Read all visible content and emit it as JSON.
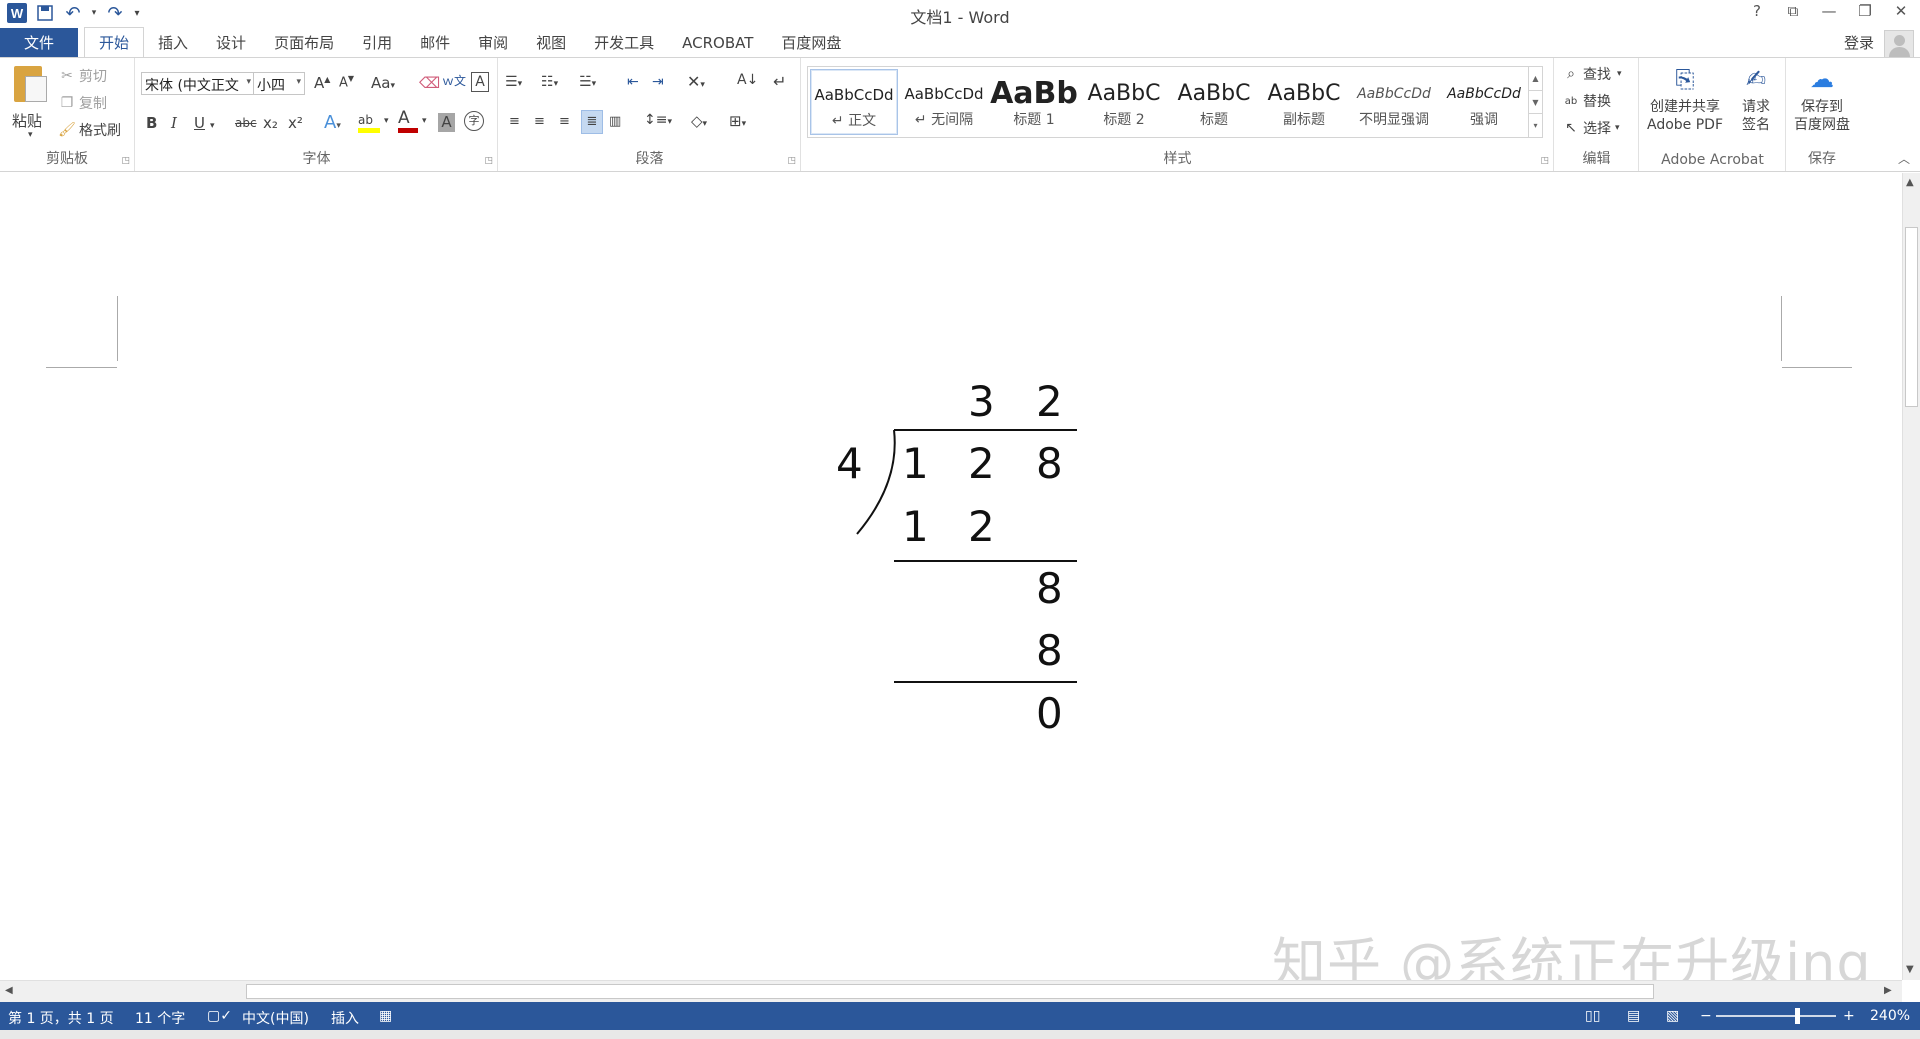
{
  "window": {
    "title": "文档1 - Word",
    "help": "?",
    "ribbon_options": "⧉",
    "minimize": "—",
    "restore": "❐",
    "close": "✕"
  },
  "qat": {
    "word_logo": "W",
    "save": "💾",
    "undo": "↶",
    "redo": "↷",
    "customize": "▾"
  },
  "tabs": [
    {
      "label": "文件"
    },
    {
      "label": "开始"
    },
    {
      "label": "插入"
    },
    {
      "label": "设计"
    },
    {
      "label": "页面布局"
    },
    {
      "label": "引用"
    },
    {
      "label": "邮件"
    },
    {
      "label": "审阅"
    },
    {
      "label": "视图"
    },
    {
      "label": "开发工具"
    },
    {
      "label": "ACROBAT"
    },
    {
      "label": "百度网盘"
    }
  ],
  "account": {
    "login": "登录"
  },
  "clipboard": {
    "label": "剪贴板",
    "paste": "粘贴",
    "cut": "剪切",
    "copy": "复制",
    "format_painter": "格式刷"
  },
  "font": {
    "label": "字体",
    "font_name": "宋体 (中文正文",
    "font_size": "小四",
    "grow": "A",
    "shrink": "A",
    "change_case": "Aa",
    "bold": "B",
    "italic": "I",
    "underline": "U",
    "strike": "abc",
    "subscript": "x₂",
    "superscript": "x²",
    "text_effects": "A",
    "highlight": "ab",
    "font_color": "A",
    "char_shading": "A",
    "enclose": "字"
  },
  "paragraph": {
    "label": "段落"
  },
  "styles": {
    "label": "样式",
    "items": [
      {
        "preview": "AaBbCcDd",
        "name": "↵ 正文"
      },
      {
        "preview": "AaBbCcDd",
        "name": "↵ 无间隔"
      },
      {
        "preview": "AaBb",
        "name": "标题 1"
      },
      {
        "preview": "AaBbC",
        "name": "标题 2"
      },
      {
        "preview": "AaBbC",
        "name": "标题"
      },
      {
        "preview": "AaBbC",
        "name": "副标题"
      },
      {
        "preview": "AaBbCcDd",
        "name": "不明显强调"
      },
      {
        "preview": "AaBbCcDd",
        "name": "强调"
      }
    ]
  },
  "editing": {
    "label": "编辑",
    "find": "查找",
    "replace": "替换",
    "select": "选择"
  },
  "acrobat": {
    "label": "Adobe Acrobat",
    "create_line1": "创建并共享",
    "create_line2": "Adobe PDF",
    "sign_line1": "请求",
    "sign_line2": "签名"
  },
  "save_group": {
    "label": "保存",
    "btn_line1": "保存到",
    "btn_line2": "百度网盘"
  },
  "document": {
    "quotient": [
      "3",
      "2"
    ],
    "divisor": "4",
    "dividend": [
      "1",
      "2",
      "8"
    ],
    "step1": [
      "1",
      "2"
    ],
    "step2_bring_down": "8",
    "step2_sub": "8",
    "remainder": "0"
  },
  "watermark": "知乎 @系统正在升级ing",
  "statusbar": {
    "page": "第 1 页，共 1 页",
    "words": "11 个字",
    "language": "中文(中国)",
    "mode": "插入",
    "zoom_minus": "−",
    "zoom_plus": "+",
    "zoom": "240%"
  },
  "colors": {
    "word_blue": "#2b579a",
    "highlight_yellow": "#ffff00",
    "font_red": "#c00000"
  }
}
